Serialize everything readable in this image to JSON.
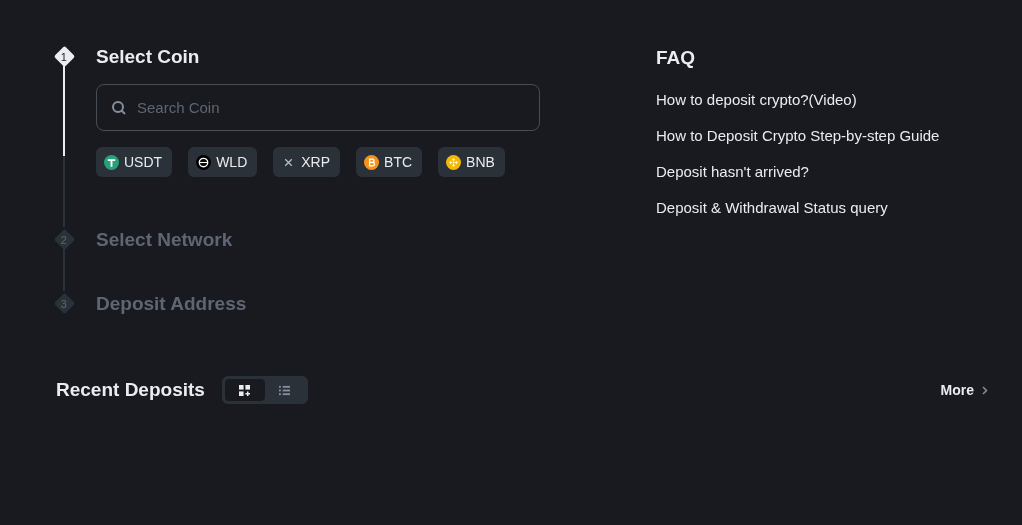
{
  "steps": [
    {
      "number": "1",
      "title": "Select Coin",
      "active": true
    },
    {
      "number": "2",
      "title": "Select Network",
      "active": false
    },
    {
      "number": "3",
      "title": "Deposit Address",
      "active": false
    }
  ],
  "search": {
    "placeholder": "Search Coin"
  },
  "coins": [
    {
      "symbol": "USDT",
      "kind": "usdt"
    },
    {
      "symbol": "WLD",
      "kind": "wld"
    },
    {
      "symbol": "XRP",
      "kind": "xrp"
    },
    {
      "symbol": "BTC",
      "kind": "btc"
    },
    {
      "symbol": "BNB",
      "kind": "bnb"
    }
  ],
  "faq": {
    "title": "FAQ",
    "links": [
      "How to deposit crypto?(Video)",
      "How to Deposit Crypto Step-by-step Guide",
      "Deposit hasn't arrived?",
      "Deposit & Withdrawal Status query"
    ]
  },
  "recent": {
    "title": "Recent Deposits",
    "views": [
      {
        "kind": "grid",
        "selected": true
      },
      {
        "kind": "list",
        "selected": false
      }
    ],
    "more": "More"
  }
}
